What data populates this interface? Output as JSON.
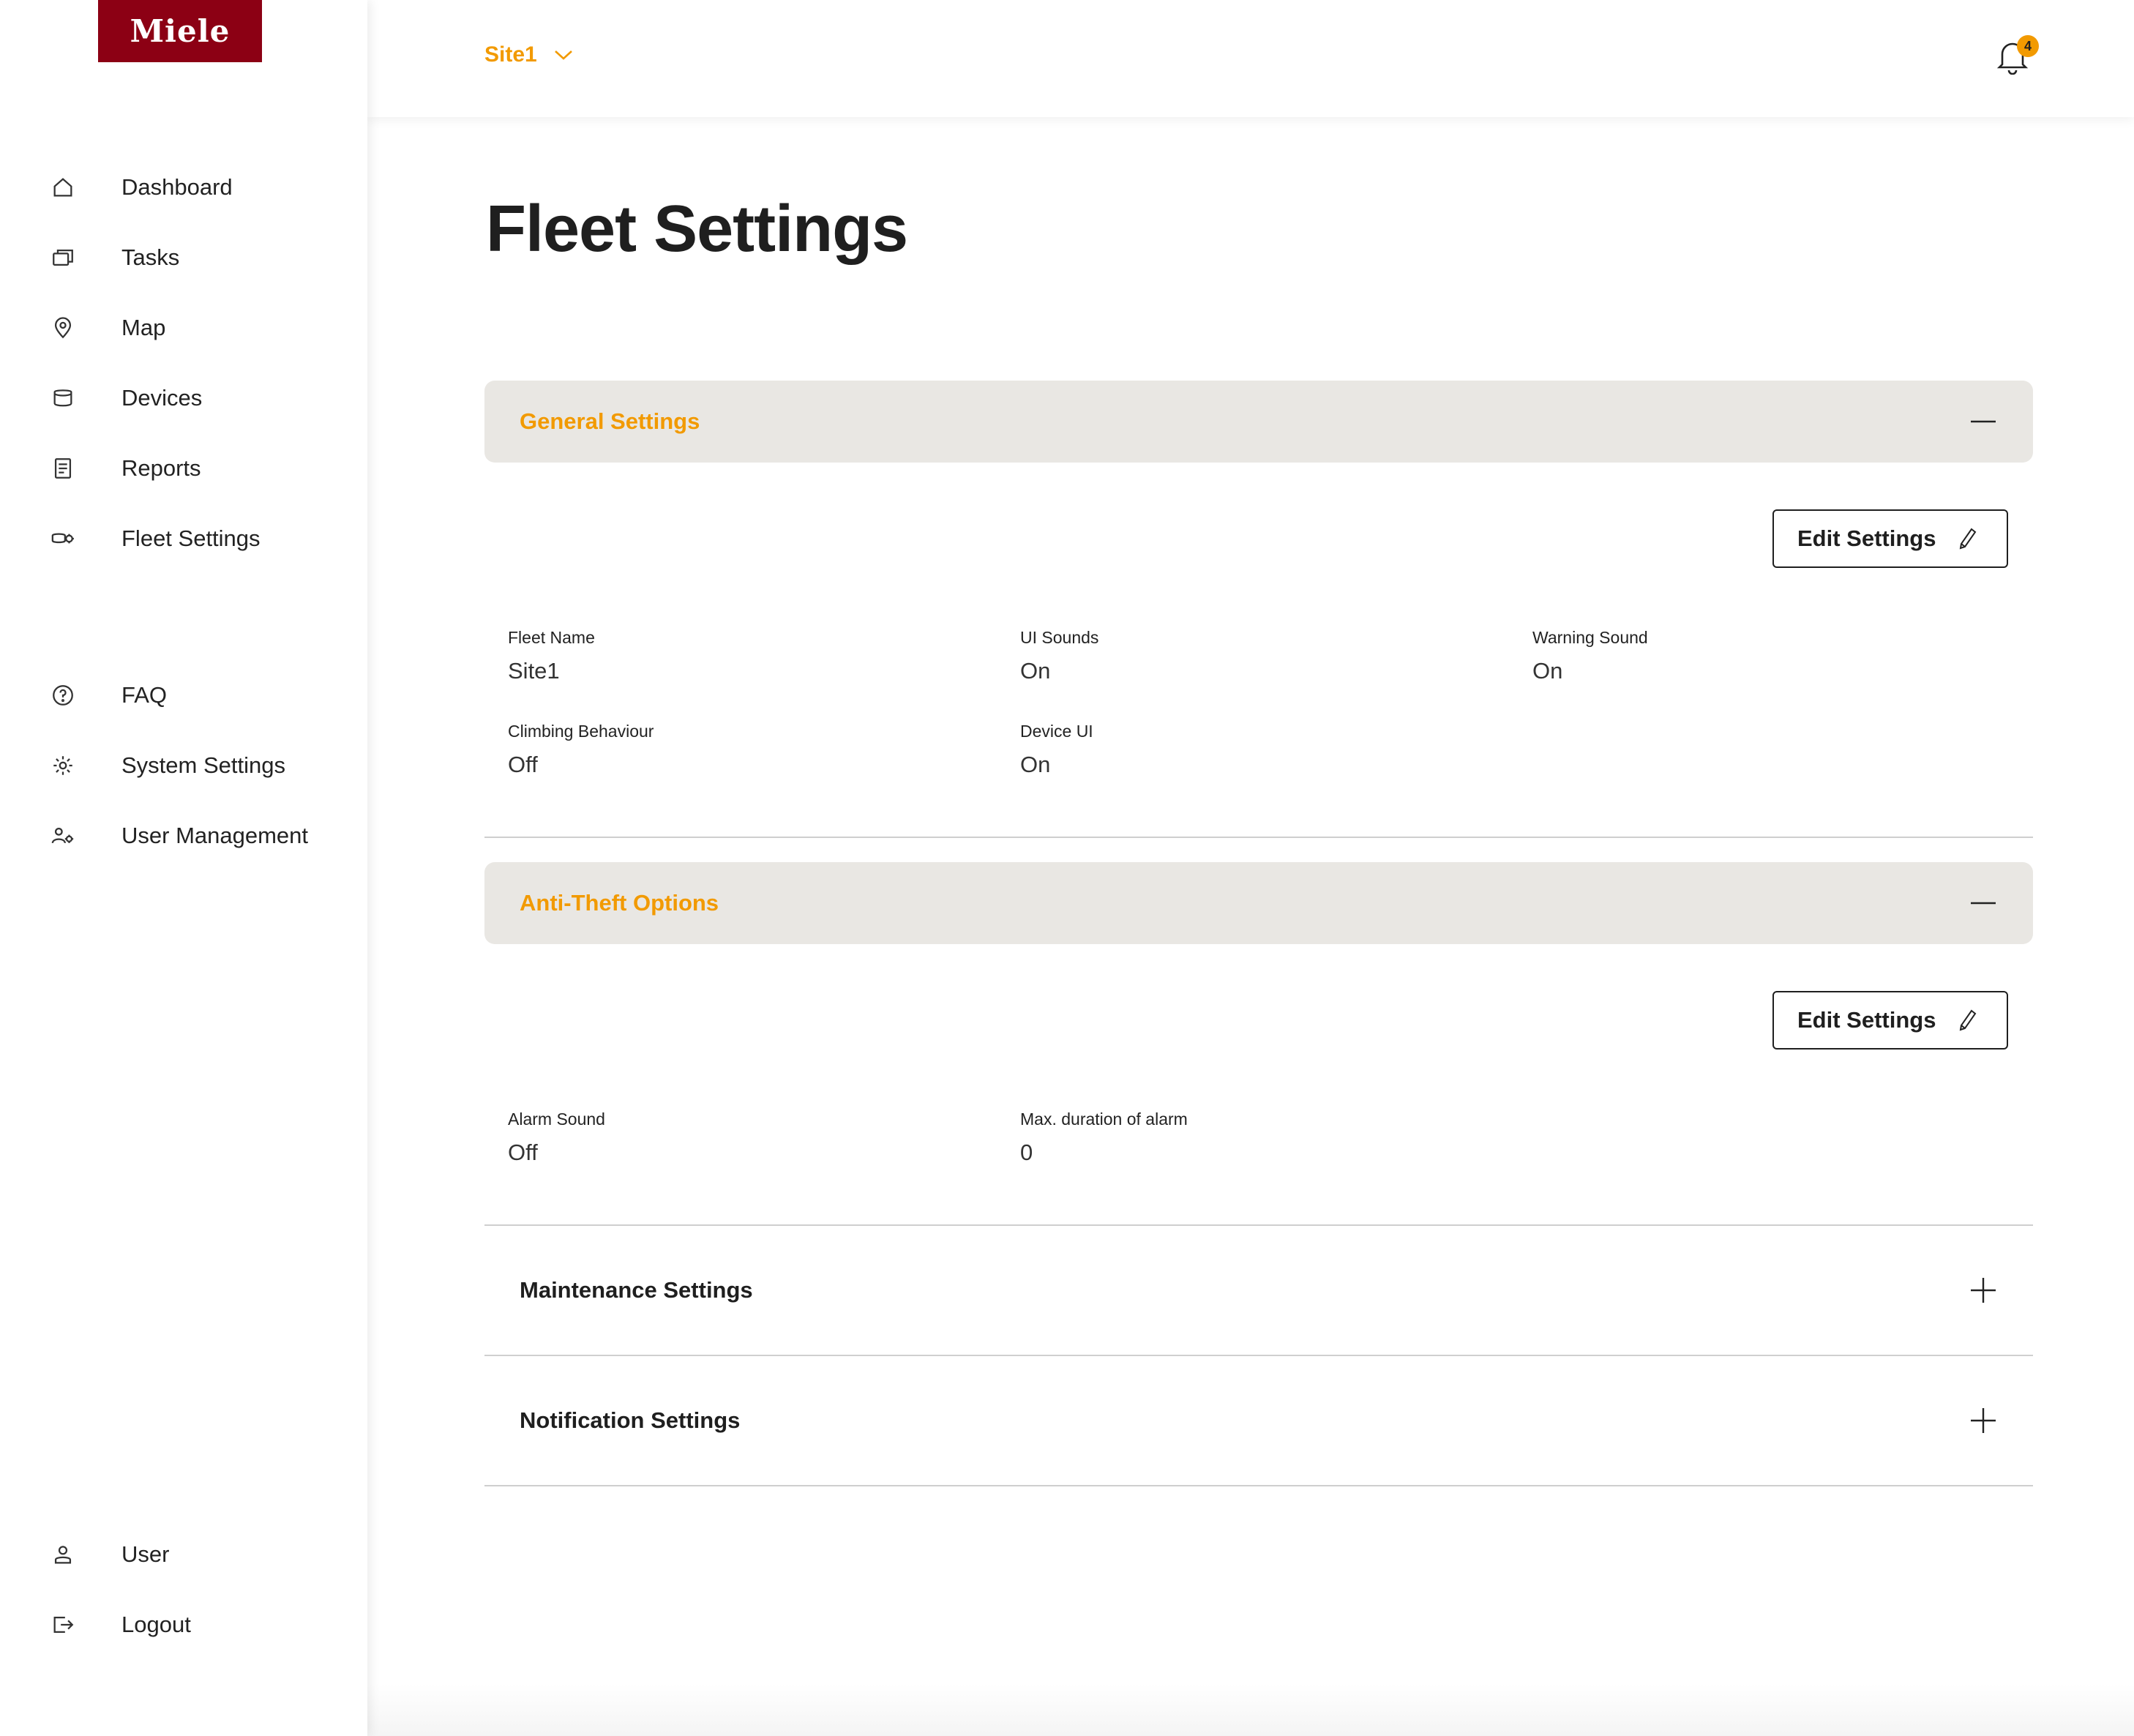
{
  "brand": {
    "logo_text": "Miele",
    "logo_color": "#8c0014"
  },
  "colors": {
    "accent": "#f29a00",
    "section_bg": "#e9e7e3",
    "text": "#1f1f1f"
  },
  "sidebar": {
    "items": [
      {
        "label": "Dashboard",
        "icon": "home-icon"
      },
      {
        "label": "Tasks",
        "icon": "tasks-icon"
      },
      {
        "label": "Map",
        "icon": "map-pin-icon"
      },
      {
        "label": "Devices",
        "icon": "device-icon"
      },
      {
        "label": "Reports",
        "icon": "report-icon"
      },
      {
        "label": "Fleet Settings",
        "icon": "fleet-icon"
      }
    ],
    "secondary": [
      {
        "label": "FAQ",
        "icon": "help-icon"
      },
      {
        "label": "System Settings",
        "icon": "gear-icon"
      },
      {
        "label": "User Management",
        "icon": "users-gear-icon"
      }
    ],
    "footer": [
      {
        "label": "User",
        "icon": "user-icon"
      },
      {
        "label": "Logout",
        "icon": "logout-icon"
      }
    ]
  },
  "header": {
    "site": "Site1",
    "notification_count": "4"
  },
  "main": {
    "title": "Fleet Settings",
    "edit_label": "Edit Settings",
    "general": {
      "title": "General Settings",
      "fields": [
        {
          "label": "Fleet Name",
          "value": "Site1"
        },
        {
          "label": "UI Sounds",
          "value": "On"
        },
        {
          "label": "Warning Sound",
          "value": "On"
        },
        {
          "label": "Climbing Behaviour",
          "value": "Off"
        },
        {
          "label": "Device UI",
          "value": "On"
        }
      ]
    },
    "anti_theft": {
      "title": "Anti-Theft Options",
      "fields": [
        {
          "label": "Alarm Sound",
          "value": "Off"
        },
        {
          "label": "Max. duration of alarm",
          "value": "0"
        }
      ]
    },
    "maintenance": {
      "title": "Maintenance Settings"
    },
    "notification": {
      "title": "Notification Settings"
    }
  }
}
